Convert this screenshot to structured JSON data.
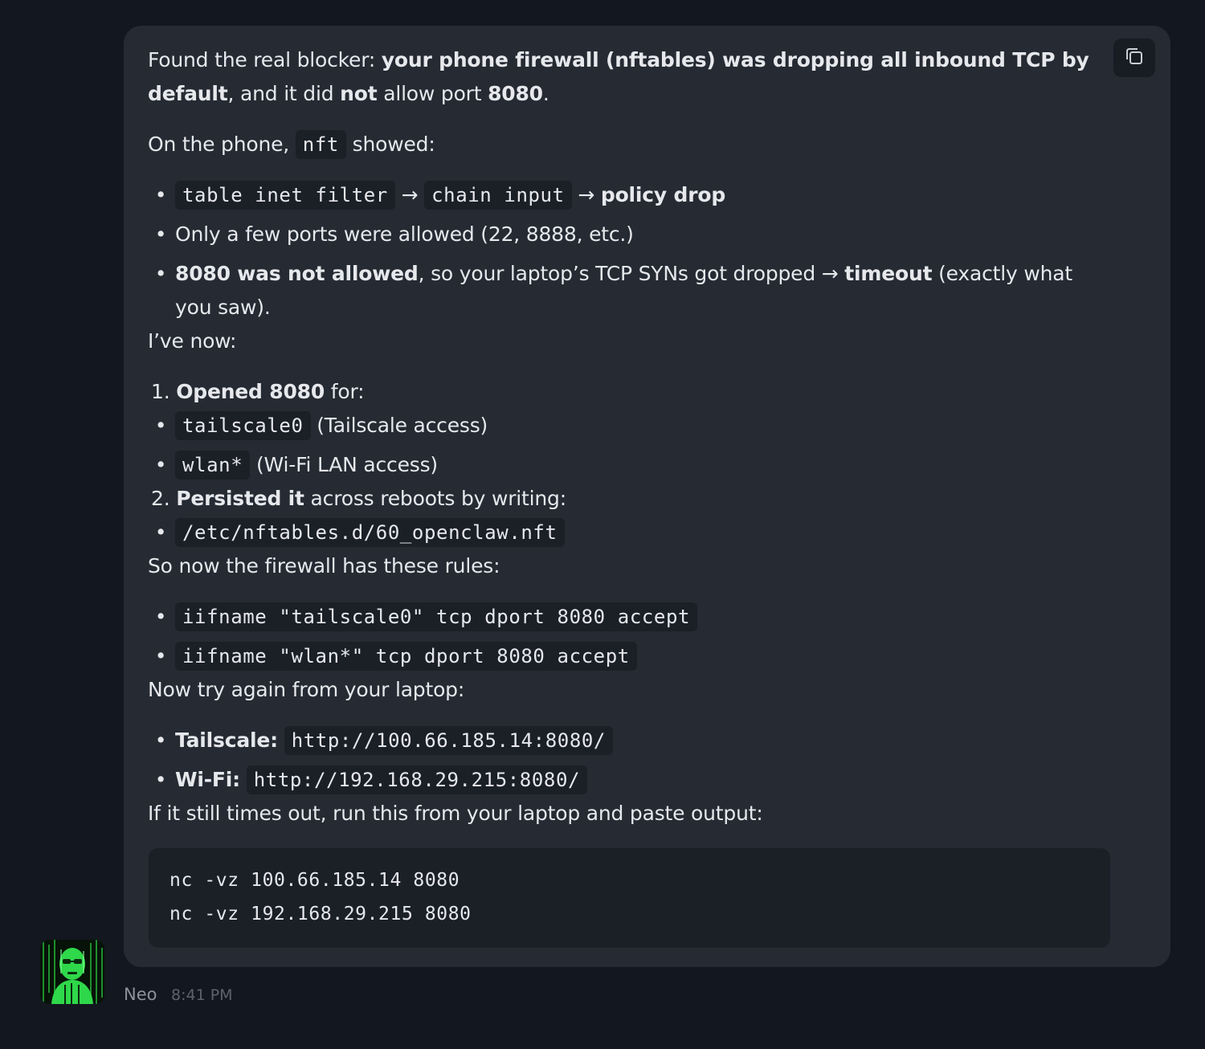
{
  "message": {
    "p1": {
      "t1": "Found the real blocker: ",
      "b1": "your phone firewall (nftables) was dropping all inbound TCP by",
      "b2": "default",
      "t2": ", and it did ",
      "b3": "not",
      "t3": " allow port ",
      "b4": "8080",
      "t4": "."
    },
    "p2": {
      "t1": "On the phone, ",
      "code": "nft",
      "t2": " showed:"
    },
    "nft_bullets": {
      "b1": {
        "code1": "table inet filter",
        "arrow1": " → ",
        "code2": "chain input",
        "arrow2": " → ",
        "bold": "policy drop"
      },
      "b2": {
        "text": "Only a few ports were allowed (22, 8888, etc.)"
      },
      "b3": {
        "bold1": "8080 was not allowed",
        "text1": ", so your laptop’s TCP SYNs got dropped → ",
        "bold2": "timeout",
        "text2": " (exactly what",
        "text3": "you saw)."
      }
    },
    "p3": "I’ve now:",
    "step1": {
      "num": "1.",
      "bold": "Opened 8080",
      "text": " for:",
      "items": [
        {
          "code": "tailscale0",
          "text": " (Tailscale access)"
        },
        {
          "code": "wlan*",
          "text": " (Wi-Fi LAN access)"
        }
      ]
    },
    "step2": {
      "num": "2.",
      "bold": "Persisted it",
      "text": " across reboots by writing:",
      "items": [
        {
          "code": "/etc/nftables.d/60_openclaw.nft"
        }
      ]
    },
    "p4": "So now the firewall has these rules:",
    "rules": [
      "iifname \"tailscale0\" tcp dport 8080 accept",
      "iifname \"wlan*\" tcp dport 8080 accept"
    ],
    "p5": "Now try again from your laptop:",
    "urls": [
      {
        "label": "Tailscale:",
        "code": "http://100.66.185.14:8080/"
      },
      {
        "label": "Wi-Fi:",
        "code": "http://192.168.29.215:8080/"
      }
    ],
    "p6": "If it still times out, run this from your laptop and paste output:",
    "code_block": [
      "nc -vz 100.66.185.14 8080",
      "nc -vz 192.168.29.215 8080"
    ],
    "bullet_char": "•"
  },
  "sender": {
    "name": "Neo",
    "time": "8:41 PM"
  },
  "icons": {
    "copy": "copy-icon",
    "avatar": "matrix-avatar-image"
  },
  "colors": {
    "page_bg": "#13171f",
    "bubble_bg": "#252a33",
    "code_bg": "#1b1f26",
    "text": "#e6e8ec",
    "muted": "#8b929d",
    "avatar_green": "#2fd84a"
  }
}
